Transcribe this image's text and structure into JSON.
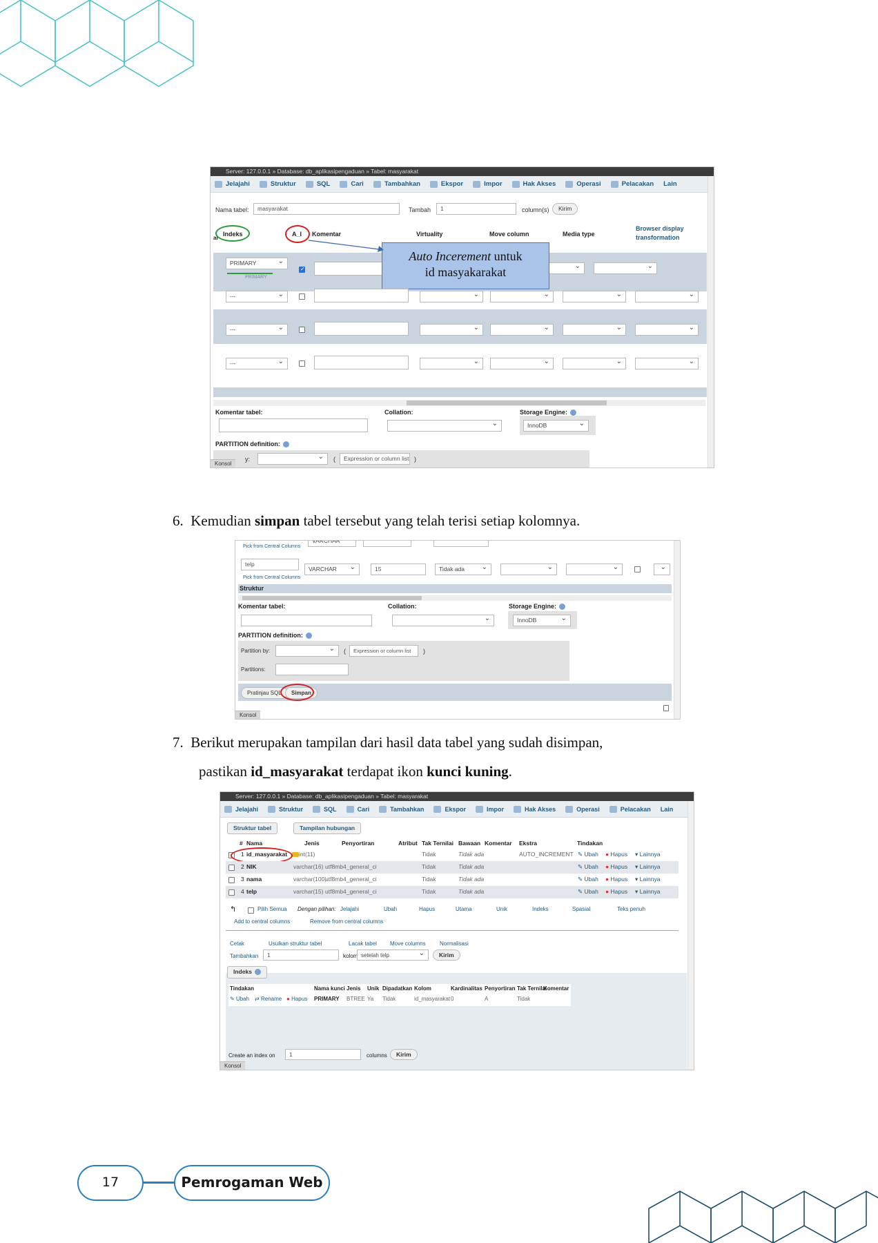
{
  "shot1": {
    "titlebar": "Server: 127.0.0.1 » Database: db_aplikasipengaduan » Tabel: masyarakat",
    "menu": [
      "Jelajahi",
      "Struktur",
      "SQL",
      "Cari",
      "Tambahkan",
      "Ekspor",
      "Impor",
      "Hak Akses",
      "Operasi",
      "Pelacakan",
      "Lain"
    ],
    "table_name_label": "Nama tabel:",
    "table_name_value": "masyarakat",
    "tambah_label": "Tambah",
    "tambah_value": "1",
    "columns_label": "column(s)",
    "kirim": "Kirim",
    "headers": {
      "ai": "ai",
      "indeks": "Indeks",
      "a_i": "A_I",
      "komentar": "Komentar",
      "virtuality": "Virtuality",
      "move_column": "Move column",
      "media_type": "Media type",
      "browser_display": "Browser display",
      "transformation": "transformation"
    },
    "row1_index": "PRIMARY",
    "row1_index_sub": "PRIMARY",
    "other_index": "---",
    "callout_italic": "Auto Incerement",
    "callout_rest": " untuk",
    "callout_line2": "id  masyakarakat",
    "komentar_tabel": "Komentar tabel:",
    "collation": "Collation:",
    "storage_engine": "Storage Engine:",
    "engine_value": "InnoDB",
    "partition_def": "PARTITION definition:",
    "partition_by_short": "y:",
    "expression_placeholder": "Expression or column list",
    "konsol": "Konsol"
  },
  "step6": {
    "number": "6.",
    "before": "Kemudian ",
    "bold": "simpan",
    "after": " tabel tersebut yang telah terisi setiap kolomnya."
  },
  "shot2": {
    "top_type": "VARCHAR",
    "pick_central": "Pick from Central Columns",
    "col_name": "telp",
    "type": "VARCHAR",
    "length": "15",
    "default": "Tidak ada",
    "struktur": "Struktur",
    "komentar_tabel": "Komentar tabel:",
    "collation": "Collation:",
    "storage_engine": "Storage Engine:",
    "engine_value": "InnoDB",
    "partition_def": "PARTITION definition:",
    "partition_by": "Partition by:",
    "expression_placeholder": "Expression or column list",
    "partitions": "Partitions:",
    "pratinjau": "Pratinjau SQL",
    "simpan": "Simpan",
    "konsol": "Konsol"
  },
  "step7": {
    "number": "7.",
    "line1": "Berikut merupakan tampilan dari hasil data tabel yang sudah disimpan,",
    "l2_a": "pastikan ",
    "l2_b": "id_masyarakat",
    "l2_c": " terdapat ikon ",
    "l2_d": "kunci kuning",
    "l2_e": "."
  },
  "shot3": {
    "titlebar": "Server: 127.0.0.1 » Database: db_aplikasipengaduan » Tabel: masyarakat",
    "menu": [
      "Jelajahi",
      "Struktur",
      "SQL",
      "Cari",
      "Tambahkan",
      "Ekspor",
      "Impor",
      "Hak Akses",
      "Operasi",
      "Pelacakan",
      "Lain"
    ],
    "subtabs": [
      "Struktur tabel",
      "Tampilan hubungan"
    ],
    "headers": [
      "#",
      "Nama",
      "Jenis",
      "Penyortiran",
      "Atribut",
      "Tak Ternilai",
      "Bawaan",
      "Komentar",
      "Ekstra",
      "Tindakan"
    ],
    "rows": [
      {
        "n": "1",
        "name": "id_masyarakat",
        "type": "int(11)",
        "coll": "",
        "null": "Tidak",
        "def": "Tidak ada",
        "extra": "AUTO_INCREMENT"
      },
      {
        "n": "2",
        "name": "NIK",
        "type": "varchar(16)",
        "coll": "utf8mb4_general_ci",
        "null": "Tidak",
        "def": "Tidak ada",
        "extra": ""
      },
      {
        "n": "3",
        "name": "nama",
        "type": "varchar(100)",
        "coll": "utf8mb4_general_ci",
        "null": "Tidak",
        "def": "Tidak ada",
        "extra": ""
      },
      {
        "n": "4",
        "name": "telp",
        "type": "varchar(15)",
        "coll": "utf8mb4_general_ci",
        "null": "Tidak",
        "def": "Tidak ada",
        "extra": ""
      }
    ],
    "row_actions": [
      "Ubah",
      "Hapus",
      "Lainnya"
    ],
    "bulk": [
      "Pilih Semua",
      "Dengan pilihan:",
      "Jelajahi",
      "Ubah",
      "Hapus",
      "Utama",
      "Unik",
      "Indeks",
      "Spasial",
      "Teks penuh"
    ],
    "central": [
      "Add to central columns",
      "Remove from central columns"
    ],
    "tools": [
      "Cetak",
      "Usulkan struktur tabel",
      "Lacak tabel",
      "Move columns",
      "Normalisasi"
    ],
    "tambahkan": "Tambahkan",
    "tambahkan_value": "1",
    "kolom": "kolom",
    "after": "setelah telp",
    "kirim": "Kirim",
    "indeks_tab": "Indeks",
    "index_headers": [
      "Tindakan",
      "Nama kunci",
      "Jenis",
      "Unik",
      "Dipadatkan",
      "Kolom",
      "Kardinalitas",
      "Penyortiran",
      "Tak Ternilai",
      "Komentar"
    ],
    "index_actions": [
      "Ubah",
      "Rename",
      "Hapus"
    ],
    "index_row": [
      "PRIMARY",
      "BTREE",
      "Ya",
      "Tidak",
      "id_masyarakat",
      "0",
      "A",
      "Tidak"
    ],
    "create_index": "Create an index on",
    "create_value": "1",
    "columns": "columns",
    "konsol": "Konsol"
  },
  "footer": {
    "page": "17",
    "title": "Pemrogaman Web"
  }
}
